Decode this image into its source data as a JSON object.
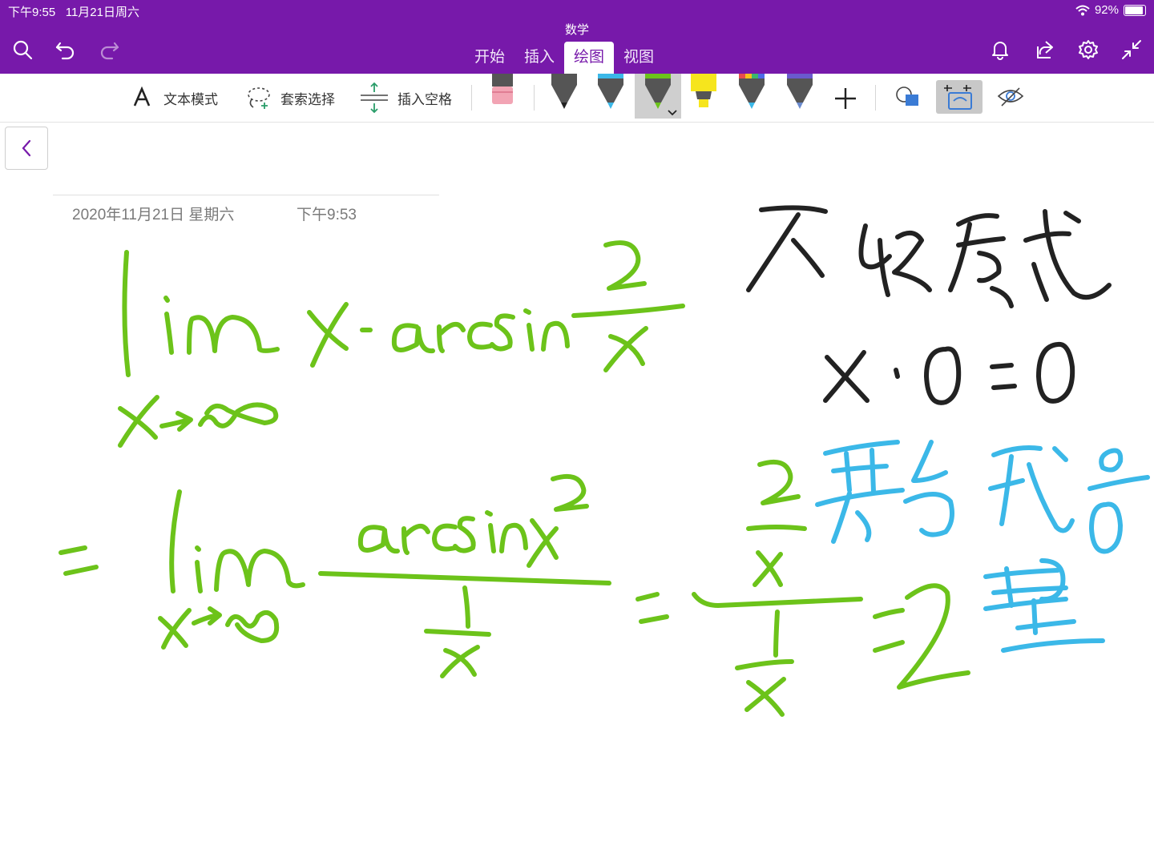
{
  "status_bar": {
    "time": "下午9:55",
    "date": "11月21日周六",
    "battery": "92%",
    "battery_level": 0.92
  },
  "header": {
    "title": "数学",
    "tabs": [
      {
        "label": "开始",
        "active": false
      },
      {
        "label": "插入",
        "active": false
      },
      {
        "label": "绘图",
        "active": true
      },
      {
        "label": "视图",
        "active": false
      }
    ],
    "icons_left": [
      "search-icon",
      "undo-icon",
      "redo-icon"
    ],
    "icons_right": [
      "bell-icon",
      "share-icon",
      "gear-icon",
      "collapse-icon"
    ]
  },
  "toolbar": {
    "text_mode_label": "文本模式",
    "lasso_label": "套索选择",
    "insert_space_label": "插入空格",
    "pens": [
      {
        "name": "eraser",
        "color": "#f2a4b4"
      },
      {
        "name": "black-pen",
        "color": "#222222"
      },
      {
        "name": "blue-pen",
        "color": "#3bb8e8"
      },
      {
        "name": "green-pen",
        "color": "#6cc31a",
        "selected": true
      },
      {
        "name": "yellow-highlighter",
        "color": "#f6e51d"
      },
      {
        "name": "rainbow-pen",
        "color": "#e84d8a"
      },
      {
        "name": "galaxy-pen",
        "color": "#6a5acd"
      }
    ]
  },
  "page": {
    "date": "2020年11月21日 星期六",
    "time": "下午9:53"
  },
  "colors": {
    "accent": "#7719aa",
    "green_ink": "#6cc31a",
    "black_ink": "#222222",
    "blue_ink": "#3bb8e8"
  }
}
